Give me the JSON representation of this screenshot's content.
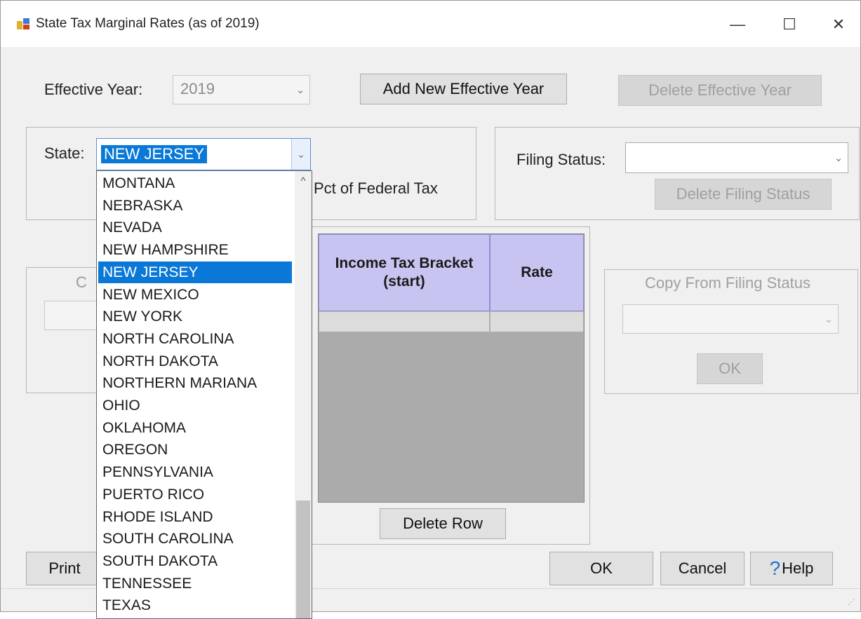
{
  "window": {
    "title": "State Tax Marginal Rates (as of 2019)",
    "controls": {
      "minimize": "—",
      "maximize": "☐",
      "close": "✕"
    }
  },
  "effective_year": {
    "label": "Effective Year:",
    "value": "2019",
    "add_button": "Add New Effective Year",
    "delete_button": "Delete Effective Year"
  },
  "state": {
    "label": "State:",
    "value": "NEW JERSEY",
    "pct_label": "Pct of Federal Tax",
    "options": [
      "MONTANA",
      "NEBRASKA",
      "NEVADA",
      "NEW HAMPSHIRE",
      "NEW JERSEY",
      "NEW MEXICO",
      "NEW YORK",
      "NORTH CAROLINA",
      "NORTH DAKOTA",
      "NORTHERN MARIANA",
      "OHIO",
      "OKLAHOMA",
      "OREGON",
      "PENNSYLVANIA",
      "PUERTO RICO",
      "RHODE ISLAND",
      "SOUTH CAROLINA",
      "SOUTH DAKOTA",
      "TENNESSEE",
      "TEXAS"
    ],
    "selected_index": 4
  },
  "filing_status": {
    "label": "Filing Status:",
    "value": "",
    "delete_button": "Delete Filing Status"
  },
  "grid": {
    "columns": [
      "Income Tax Bracket (start)",
      "Rate"
    ],
    "delete_row_button": "Delete Row"
  },
  "copy_from": {
    "label": "Copy From Filing Status",
    "value": "",
    "ok_button": "OK"
  },
  "left_group": {
    "partial_label": "C"
  },
  "buttons": {
    "print": "Print",
    "ok": "OK",
    "cancel": "Cancel",
    "help": "Help",
    "help_icon_glyph": "?"
  },
  "colors": {
    "selection": "#0a78d7",
    "grid_header": "#c8c4f2"
  }
}
